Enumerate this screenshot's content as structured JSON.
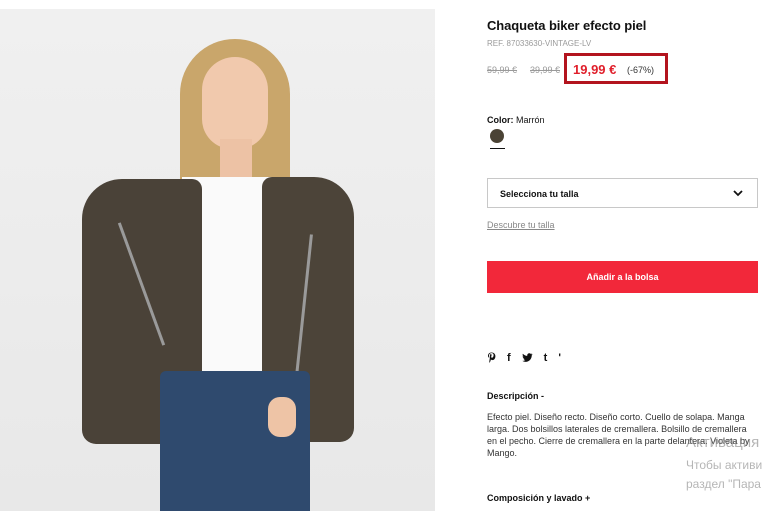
{
  "product": {
    "title": "Chaqueta biker efecto piel",
    "reference": "REF. 87033630-VINTAGE-LV",
    "original_price": "59,99 €",
    "previous_price": "39,99 €",
    "price": "19,99 €",
    "discount": "(-67%)",
    "color_label": "Color:",
    "color_value": "Marrón",
    "swatch_color": "#4b4335"
  },
  "size": {
    "select_label": "Selecciona tu talla",
    "guide_link": "Descubre tu talla"
  },
  "cart": {
    "add_button": "Añadir a la bolsa"
  },
  "share": {
    "icons": [
      "pinterest-icon",
      "facebook-icon",
      "twitter-icon",
      "tumblr-icon",
      "more-icon"
    ],
    "glyphs": [
      "𝓅",
      "f",
      "",
      "t",
      "'"
    ]
  },
  "description": {
    "heading": "Descripción -",
    "text": "Efecto piel. Diseño recto. Diseño corto. Cuello de solapa. Manga larga. Dos bolsillos laterales de cremallera. Bolsillo de cremallera en el pecho. Cierre de cremallera en la parte delantera. Violeta by Mango."
  },
  "composition": {
    "heading": "Composición y lavado +"
  },
  "watermark": {
    "line1": "Активация",
    "line2": "Чтобы активи",
    "line3": "раздел \"Пара"
  },
  "colors": {
    "accent": "#f2283a",
    "price_red": "#e01f2b",
    "highlight_box": "#b3141e"
  }
}
